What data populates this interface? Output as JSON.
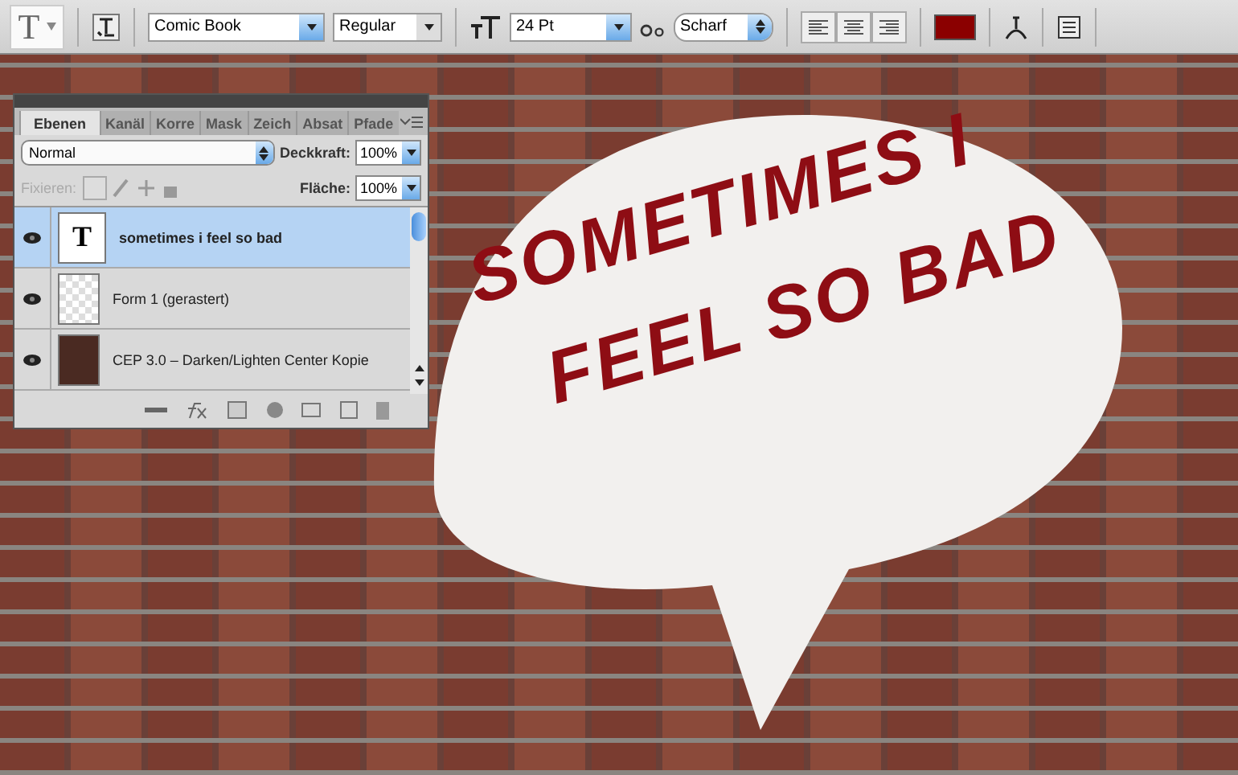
{
  "toolbar": {
    "tool_glyph": "T",
    "font_family": "Comic Book",
    "font_style": "Regular",
    "font_size": "24 Pt",
    "antialias": "Scharf",
    "align": [
      {
        "kind": "left",
        "selected": false
      },
      {
        "kind": "center",
        "selected": false
      },
      {
        "kind": "right",
        "selected": false
      }
    ]
  },
  "layers_panel": {
    "tabs": [
      {
        "label": "Ebenen",
        "selected": true
      },
      {
        "label": "Kanäl",
        "selected": false
      },
      {
        "label": "Korre",
        "selected": false
      },
      {
        "label": "Mask",
        "selected": false
      },
      {
        "label": "Zeich",
        "selected": false
      },
      {
        "label": "Absat",
        "selected": false
      },
      {
        "label": "Pfade",
        "selected": false
      }
    ],
    "blend_mode": "Normal",
    "opacity_label": "Deckkraft:",
    "opacity": "100%",
    "lock_label": "Fixieren:",
    "fill_label": "Fläche:",
    "fill": "100%",
    "layers": [
      {
        "kind": "text",
        "thumb_glyph": "T",
        "name": "sometimes i feel so bad",
        "selected": true,
        "visible": true
      },
      {
        "kind": "shape",
        "name": "Form 1 (gerastert)",
        "selected": false,
        "visible": true
      },
      {
        "kind": "photo",
        "name": "CEP 3.0 – Darken/Lighten Center Kopie",
        "selected": false,
        "visible": true
      }
    ]
  },
  "canvas": {
    "text_lines": [
      "SOMETIMES I",
      "FEEL SO BAD"
    ]
  }
}
